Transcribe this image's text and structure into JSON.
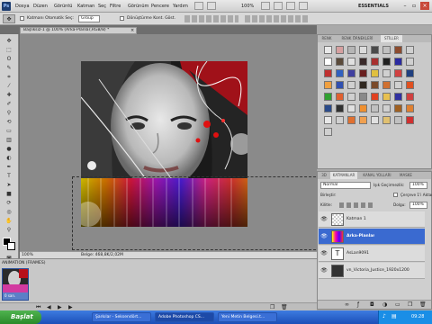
{
  "app": {
    "logo": "Ps",
    "menus": [
      "Dosya",
      "Düzen",
      "Görüntü",
      "Katman",
      "Seç",
      "Filtre",
      "Görünüm",
      "Pencere",
      "Yardım"
    ],
    "zoom": "100%",
    "workspace": "ESSENTIALS"
  },
  "options_bar": {
    "auto_select_label": "Katmanı Otomatik Seç:",
    "auto_select_value": "Group",
    "transform_label": "Dönüştürme Kont. Göst."
  },
  "document": {
    "tab_title": "Başlıksız-1 @ 100% (Arka-Planlar,RGB/8) *",
    "zoom": "100%",
    "info": "Belge: 468,8K/2,02M"
  },
  "animation": {
    "title": "ANIMATION (FRAMES)",
    "frame_label": "0 san."
  },
  "styles_panel": {
    "tabs": [
      "RENK",
      "RENK ÖRNEKLERİ",
      "STİLLER"
    ],
    "swatch_colors": [
      "#e9e9e9",
      "#d6a0a0",
      "#b5b5b5",
      "#dcdcdc",
      "#4a4a4a",
      "#c0c0c0",
      "#8c4b2e",
      "#d0d0d0",
      "#ffffff",
      "#5a4a3a",
      "#e0e0e0",
      "#3a2a2a",
      "#a83030",
      "#202020",
      "#2a2aa0",
      "#d0d0d0",
      "#c03030",
      "#3060c0",
      "#4040a0",
      "#6a2020",
      "#e0c040",
      "#d0d0d0",
      "#d04040",
      "#204080",
      "#f0a040",
      "#3050b0",
      "#d0d0d0",
      "#302820",
      "#7a4a2a",
      "#d07030",
      "#d0d0d0",
      "#e05020",
      "#30a030",
      "#e06030",
      "#d0d0d0",
      "#8a8a8a",
      "#e04020",
      "#e8c050",
      "#3030a0",
      "#d04040",
      "#2a4a8a",
      "#303030",
      "#e0e0e0",
      "#f09030",
      "#c0c0c0",
      "#d0d0d0",
      "#a06020",
      "#e08030",
      "#e8e8e8",
      "#d0d0d0",
      "#e07030",
      "#f0a050",
      "#e0e0e0",
      "#e0c070",
      "#c0c0c0",
      "#d03030",
      "#d0d0d0"
    ]
  },
  "layers_panel": {
    "tabs": [
      "3D",
      "KATMANLAR",
      "KANAL YOLLARI",
      "MASKE"
    ],
    "blend_mode": "Normal",
    "opacity_label": "Işık Geçirmezlik:",
    "opacity_value": "100%",
    "lock_label": "Kilitle:",
    "fill_label": "Dolgu:",
    "fill_value": "100%",
    "propagate_label": "Çerçeve 1'i Aktar",
    "layers": [
      {
        "name": "Katman 1",
        "selected": false
      },
      {
        "name": "Arka-Planlar",
        "selected": true
      },
      {
        "name": "AsLan9091",
        "selected": false
      },
      {
        "name": "vn_Victoria_Justice_1920x1200",
        "selected": false
      }
    ]
  },
  "taskbar": {
    "start_label": "Başlat",
    "tasks": [
      "Şarkılar - Seksendört...",
      "Adobe Photoshop CS...",
      "Yeni Metin Belgesi.t..."
    ],
    "clock": "09:28"
  }
}
